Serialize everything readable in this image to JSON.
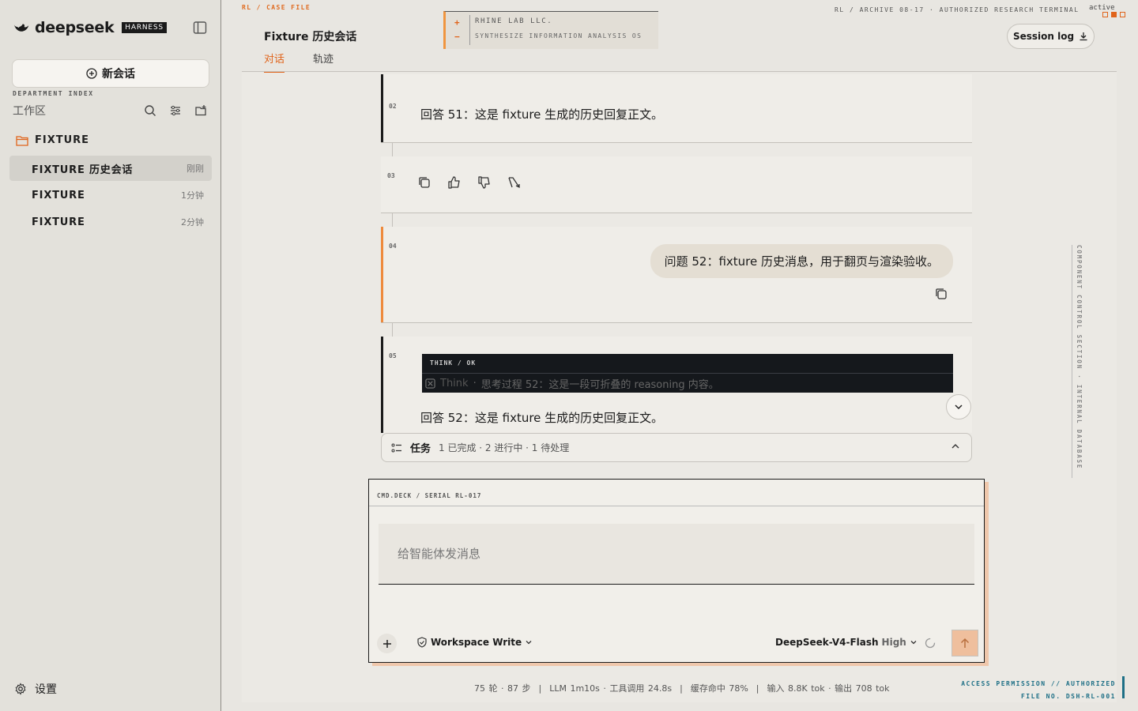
{
  "sidebar": {
    "brand": "deepseek",
    "brand_tag": "HARNESS",
    "new_chat_label": "新会话",
    "dept_label": "DEPARTMENT INDEX",
    "workspace_label": "工作区",
    "folder_label": "FIXTURE",
    "sessions": [
      {
        "title": "FIXTURE 历史会话",
        "time": "刚刚"
      },
      {
        "title": "FIXTURE",
        "time": "1分钟"
      },
      {
        "title": "FIXTURE",
        "time": "2分钟"
      }
    ],
    "settings_label": "设置"
  },
  "header": {
    "crumb_left": "RL / CASE FILE",
    "title": "Fixture 历史会话",
    "tabs": [
      {
        "label": "对话"
      },
      {
        "label": "轨迹"
      }
    ],
    "rhine_line1": "RHINE LAB LLC.",
    "rhine_line2": "SYNTHESIZE INFORMATION ANALYSIS OS",
    "rhine_plus": "+",
    "rhine_minus": "−",
    "crumb_right": "RL / ARCHIVE 08-17 · AUTHORIZED RESEARCH TERMINAL",
    "active_label": "active",
    "session_log_label": "Session log"
  },
  "messages": [
    {
      "num": "02",
      "text": "回答 51：这是 fixture 生成的历史回复正文。"
    },
    {
      "num": "03"
    },
    {
      "num": "04",
      "text": "问题 52：fixture 历史消息，用于翻页与渲染验收。"
    },
    {
      "num": "05",
      "think_label": "THINK / OK",
      "think_word": "Think",
      "think_text": "思考过程 52：这是一段可折叠的 reasoning 内容。",
      "text": "回答 52：这是 fixture 生成的历史回复正文。"
    }
  ],
  "tasks": {
    "label": "任务",
    "summary": "1 已完成 · 2 进行中 · 1 待处理"
  },
  "composer": {
    "header": "CMD.DECK / SERIAL RL-017",
    "placeholder": "给智能体发消息",
    "permission_label": "Workspace Write",
    "model_name": "DeepSeek-V4-Flash",
    "model_level": "High"
  },
  "footer": {
    "turns": "75 轮 · 87 步",
    "llm": "LLM 1m10s · 工具调用 24.8s",
    "cache": "缓存命中 78%",
    "tokens": "输入 8.8K tok · 输出 708 tok",
    "access_line1": "ACCESS PERMISSION // AUTHORIZED",
    "access_line2": "FILE NO. DSH-RL-001"
  },
  "side_vertical": "COMPONENT CONTROL SECTION · INTERNAL DATABASE",
  "colors": {
    "accent": "#e0641b",
    "dark": "#15181c",
    "teal": "#1d6f86"
  }
}
